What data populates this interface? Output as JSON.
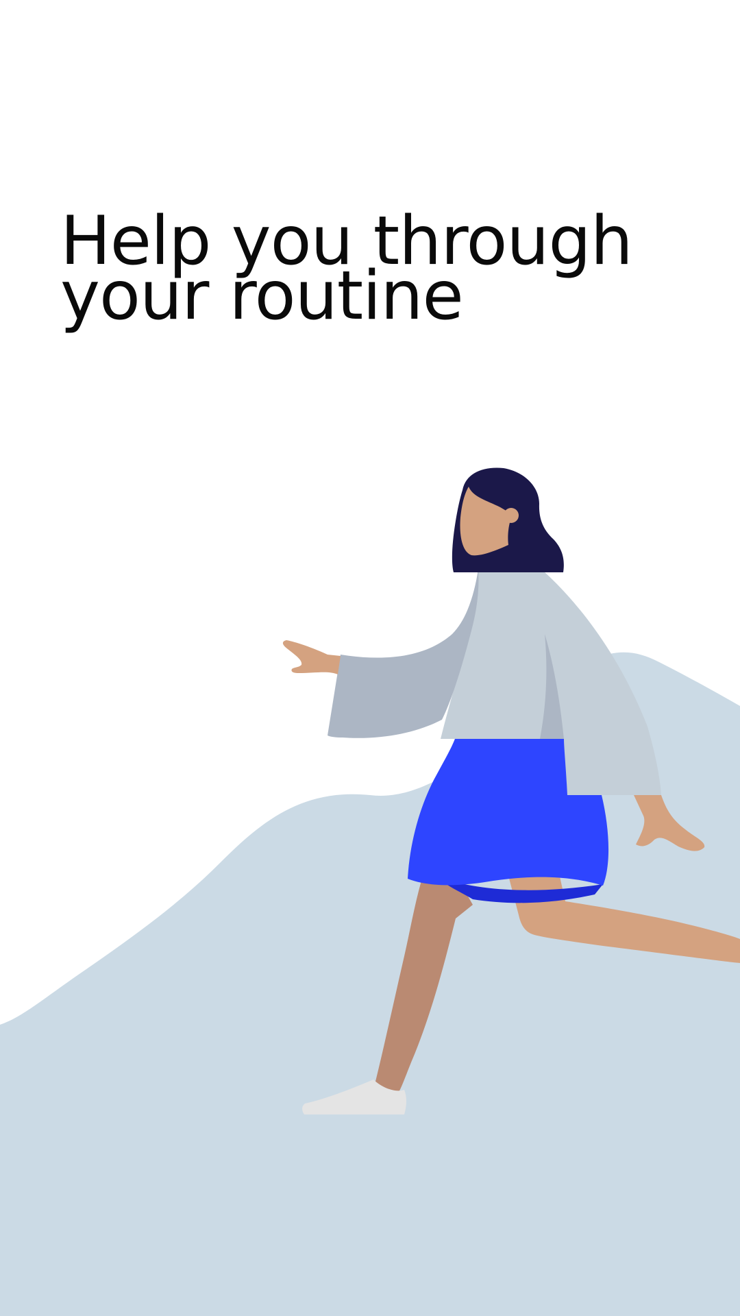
{
  "onboarding": {
    "headline_line1": "Help you through",
    "headline_line2": "your routine"
  },
  "illustration": {
    "subject": "woman-walking-uphill",
    "colors": {
      "hill": "#CBDAE5",
      "hair": "#1B1849",
      "skin": "#D4A280",
      "skin_shadow": "#BA8A72",
      "top": "#C4CFD8",
      "top_shadow": "#ACB6C4",
      "skirt": "#2E45FF",
      "skirt_shadow": "#1E2BD6",
      "shoe": "#E4E4E4"
    }
  }
}
